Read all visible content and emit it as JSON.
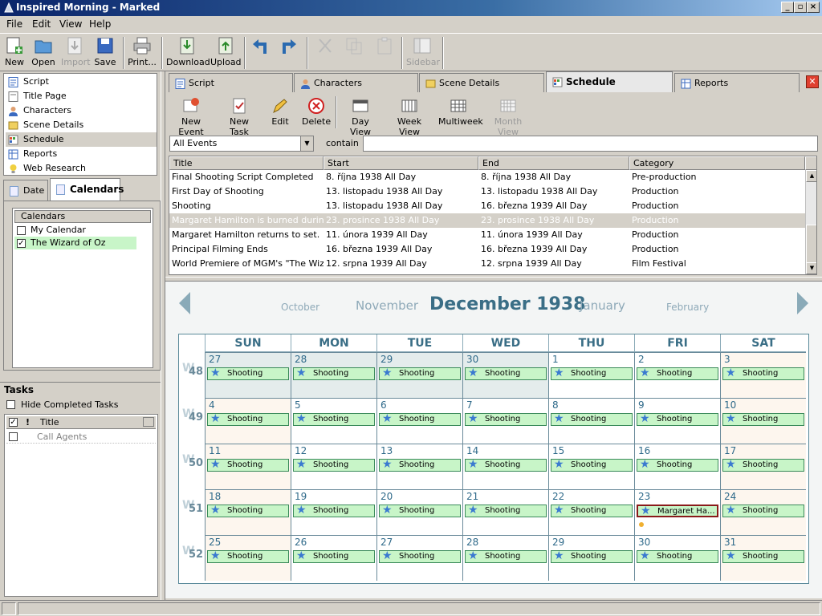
{
  "window": {
    "title": "Inspired Morning - Marked",
    "minimize": "_",
    "maximize": "▫",
    "close": "×"
  },
  "menu": [
    "File",
    "Edit",
    "View",
    "Help"
  ],
  "toolbar": {
    "new": "New",
    "open": "Open",
    "import": "Import",
    "save": "Save",
    "print": "Print...",
    "download": "Download",
    "upload": "Upload",
    "sidebar": "Sidebar"
  },
  "nav": [
    {
      "label": "Script",
      "icon": "script-icon"
    },
    {
      "label": "Title Page",
      "icon": "title-page-icon"
    },
    {
      "label": "Characters",
      "icon": "person-icon"
    },
    {
      "label": "Scene Details",
      "icon": "scene-details-icon"
    },
    {
      "label": "Schedule",
      "icon": "calendar-icon"
    },
    {
      "label": "Reports",
      "icon": "reports-icon"
    },
    {
      "label": "Web Research",
      "icon": "lightbulb-icon"
    }
  ],
  "sidetabs": {
    "date": "Date",
    "calendars": "Calendars"
  },
  "calendars": {
    "header": "Calendars",
    "items": [
      {
        "label": "My Calendar",
        "checked": "",
        "color": "#ffffff"
      },
      {
        "label": "The Wizard of Oz",
        "checked": "✓",
        "color": "#c8f5c8"
      }
    ]
  },
  "tasks": {
    "title": "Tasks",
    "hide_completed": "Hide Completed Tasks",
    "check_col": "✓",
    "priority_col": "!",
    "title_col": "Title",
    "items": [
      "Call Agents"
    ]
  },
  "main_tabs": [
    "Script",
    "Characters",
    "Scene Details",
    "Schedule",
    "Reports"
  ],
  "close_tab": "✕",
  "schedule_toolbar": {
    "new_event": "New Event",
    "new_task": "New Task",
    "edit": "Edit",
    "delete": "Delete",
    "day_view": "Day View",
    "week_view": "Week View",
    "multiweek": "Multiweek",
    "month_view": "Month View"
  },
  "filter": {
    "select_value": "All Events",
    "contain_label": "contain",
    "contain_value": ""
  },
  "event_table": {
    "columns": [
      "Title",
      "Start",
      "End",
      "Category"
    ],
    "rows": [
      {
        "title": "Final Shooting Script  Completed",
        "start": "8. října 1938 All Day",
        "end": "8. října 1938 All Day",
        "category": "Pre-production"
      },
      {
        "title": "First Day of Shooting",
        "start": "13. listopadu 1938 All Day",
        "end": "13. listopadu 1938 All Day",
        "category": "Production"
      },
      {
        "title": "Shooting",
        "start": "13. listopadu 1938 All Day",
        "end": "16. března 1939 All Day",
        "category": "Production"
      },
      {
        "title": "Margaret Hamilton is burned during ...",
        "start": "23. prosince 1938 All Day",
        "end": "23. prosince 1938 All Day",
        "category": "Production"
      },
      {
        "title": "Margaret Hamilton returns to set.",
        "start": "11. února 1939 All Day",
        "end": "11. února 1939 All Day",
        "category": "Production"
      },
      {
        "title": "Principal Filming Ends",
        "start": "16. března 1939 All Day",
        "end": "16. března 1939 All Day",
        "category": "Production"
      },
      {
        "title": "World Premiere of MGM's \"The Wiza...",
        "start": "12. srpna 1939 All Day",
        "end": "12. srpna 1939 All Day",
        "category": "Film Festival"
      }
    ]
  },
  "calendar": {
    "prev2": "October",
    "prev1": "November",
    "current": "December 1938",
    "next1": "January",
    "next2": "February",
    "days": [
      "SUN",
      "MON",
      "TUE",
      "WED",
      "THU",
      "FRI",
      "SAT"
    ],
    "week_prefix": "W",
    "weeks": [
      {
        "num": "48",
        "dates": [
          "27",
          "28",
          "29",
          "30",
          "1",
          "2",
          "3"
        ]
      },
      {
        "num": "49",
        "dates": [
          "4",
          "5",
          "6",
          "7",
          "8",
          "9",
          "10"
        ]
      },
      {
        "num": "50",
        "dates": [
          "11",
          "12",
          "13",
          "14",
          "15",
          "16",
          "17"
        ]
      },
      {
        "num": "51",
        "dates": [
          "18",
          "19",
          "20",
          "21",
          "22",
          "23",
          "24"
        ]
      },
      {
        "num": "52",
        "dates": [
          "25",
          "26",
          "27",
          "28",
          "29",
          "30",
          "31"
        ]
      }
    ],
    "event_label": "Shooting",
    "highlight_event": "Margaret Ha...",
    "event_color": "#c8f5c8"
  }
}
